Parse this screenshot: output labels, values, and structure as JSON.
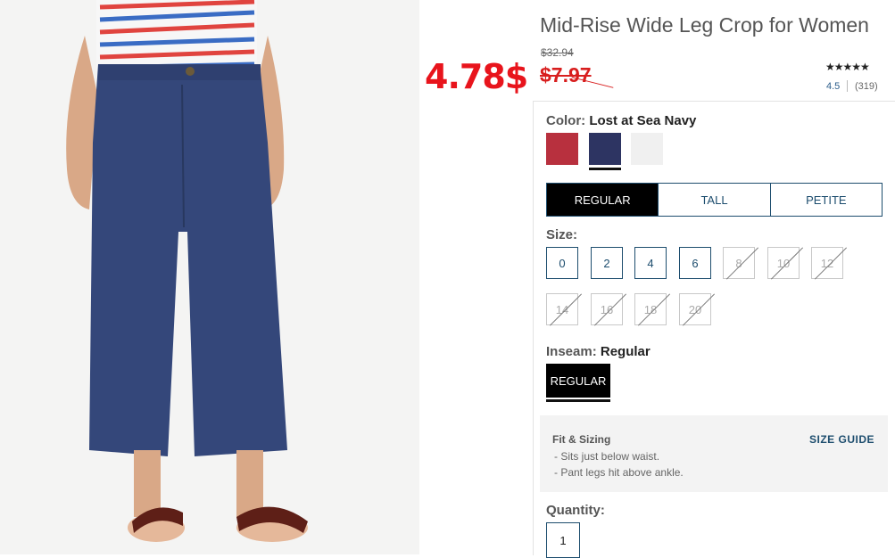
{
  "product": {
    "title": "Mid-Rise Wide Leg Crop for Women",
    "original_price": "$32.94",
    "sale_price": "$7.97",
    "promo_price": "4.78$",
    "stars": "★★★★★",
    "rating": "4.5",
    "review_count": "(319)"
  },
  "color": {
    "label": "Color:",
    "selected": "Lost at Sea Navy",
    "swatches": [
      {
        "name": "red",
        "hex": "#b8303e"
      },
      {
        "name": "navy",
        "hex": "#2d3462"
      },
      {
        "name": "white",
        "hex": "#f0f0f0"
      }
    ]
  },
  "fit_tabs": [
    "REGULAR",
    "TALL",
    "PETITE"
  ],
  "size": {
    "label": "Size:",
    "options": [
      {
        "label": "0",
        "available": true
      },
      {
        "label": "2",
        "available": true
      },
      {
        "label": "4",
        "available": true
      },
      {
        "label": "6",
        "available": true
      },
      {
        "label": "8",
        "available": false
      },
      {
        "label": "10",
        "available": false
      },
      {
        "label": "12",
        "available": false
      },
      {
        "label": "14",
        "available": false
      },
      {
        "label": "16",
        "available": false
      },
      {
        "label": "18",
        "available": false
      },
      {
        "label": "20",
        "available": false
      }
    ]
  },
  "inseam": {
    "label": "Inseam:",
    "selected": "Regular",
    "button": "REGULAR"
  },
  "fit_sizing": {
    "title": "Fit & Sizing",
    "items": [
      "- Sits just below waist.",
      "- Pant legs hit above ankle."
    ],
    "guide_link": "SIZE GUIDE"
  },
  "quantity": {
    "label": "Quantity:",
    "value": "1"
  },
  "colors": {
    "accent": "#1d4d6e",
    "sale": "#d81e1e",
    "promo": "#e8141c"
  }
}
